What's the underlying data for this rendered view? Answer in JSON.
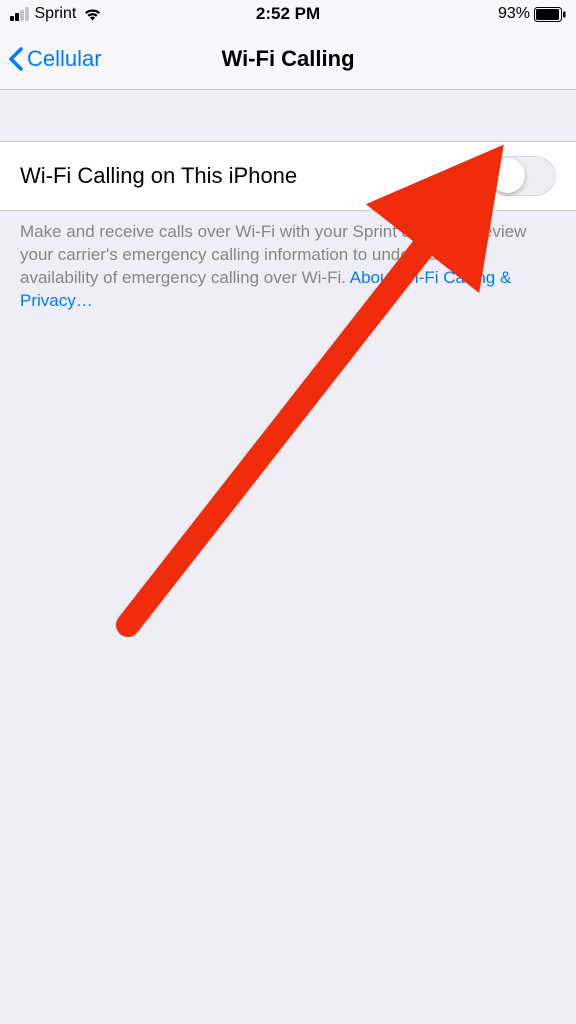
{
  "status": {
    "carrier": "Sprint",
    "time": "2:52 PM",
    "battery_pct": "93%"
  },
  "nav": {
    "back_label": "Cellular",
    "title": "Wi-Fi Calling"
  },
  "setting": {
    "label": "Wi-Fi Calling on This iPhone",
    "toggle_on": false
  },
  "footer": {
    "text_part1": "Make and receive calls over Wi-Fi with your Sprint account. Review your carrier's emergency calling information to understand the availability of emergency calling over Wi-Fi. ",
    "link_text": "About Wi-Fi Calling & Privacy…"
  }
}
